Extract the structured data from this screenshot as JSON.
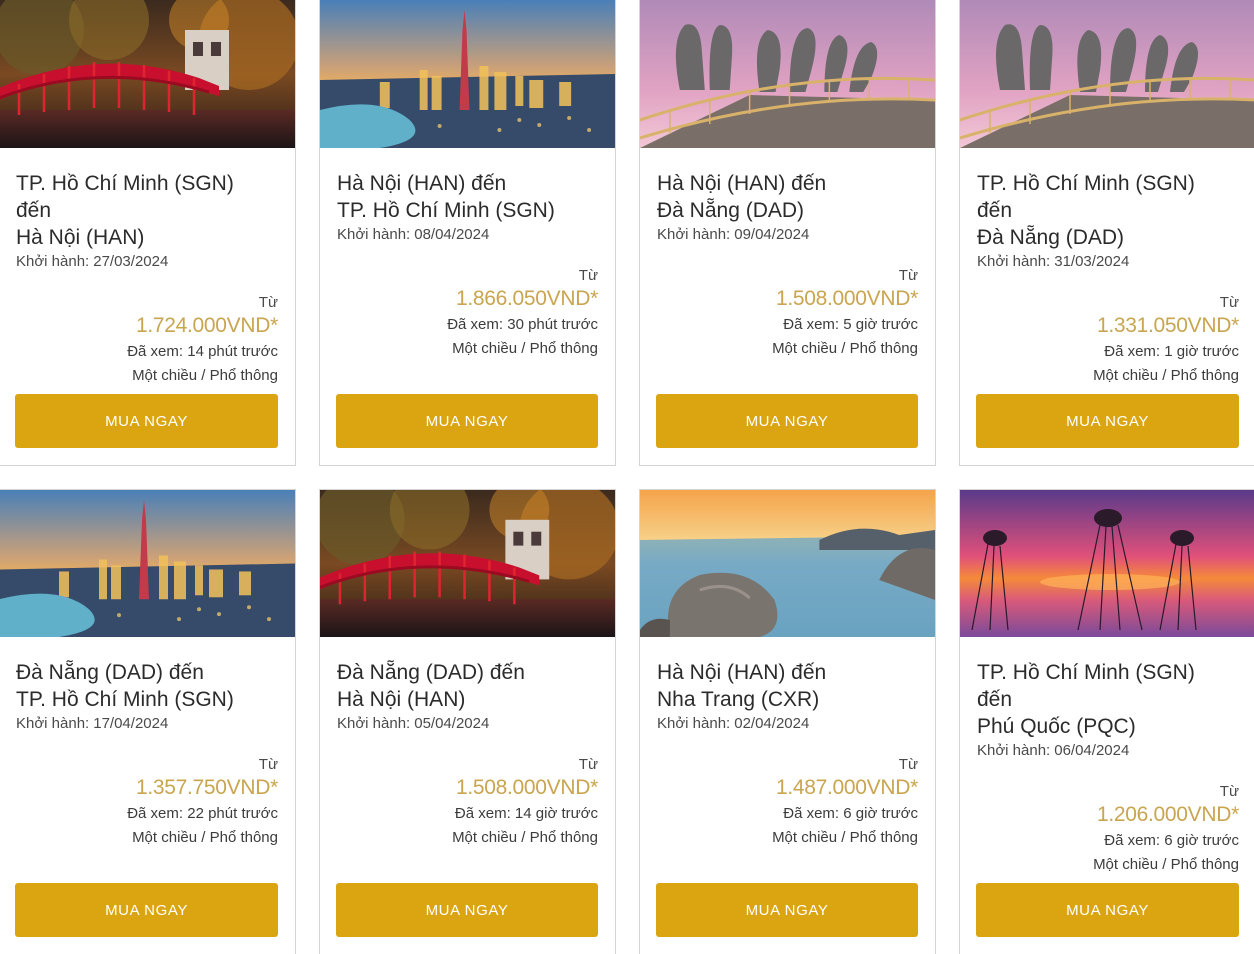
{
  "common": {
    "depart_label": "Khởi hành:",
    "from_label": "Từ",
    "buy_label": "MUA NGAY"
  },
  "cards": [
    {
      "route_lines": [
        "TP. Hồ Chí Minh (SGN)",
        "đến",
        "Hà Nội (HAN)"
      ],
      "depart_date": "27/03/2024",
      "price": "1.724.000VND*",
      "viewed": "Đã xem: 14 phút trước",
      "fare": "Một chiều / Phổ thông",
      "image": "hanoi-red-bridge"
    },
    {
      "route_lines": [
        "Hà Nội (HAN) đến",
        "TP. Hồ Chí Minh (SGN)"
      ],
      "depart_date": "08/04/2024",
      "price": "1.866.050VND*",
      "viewed": "Đã xem: 30 phút trước",
      "fare": "Một chiều / Phổ thông",
      "image": "saigon-skyline"
    },
    {
      "route_lines": [
        "Hà Nội (HAN) đến",
        "Đà Nẵng (DAD)"
      ],
      "depart_date": "09/04/2024",
      "price": "1.508.000VND*",
      "viewed": "Đã xem: 5 giờ trước",
      "fare": "Một chiều / Phổ thông",
      "image": "golden-bridge-hands"
    },
    {
      "route_lines": [
        "TP. Hồ Chí Minh (SGN)",
        "đến",
        "Đà Nẵng (DAD)"
      ],
      "depart_date": "31/03/2024",
      "price": "1.331.050VND*",
      "viewed": "Đã xem: 1 giờ trước",
      "fare": "Một chiều / Phổ thông",
      "image": "golden-bridge-hands"
    },
    {
      "route_lines": [
        "Đà Nẵng (DAD) đến",
        "TP. Hồ Chí Minh (SGN)"
      ],
      "depart_date": "17/04/2024",
      "price": "1.357.750VND*",
      "viewed": "Đã xem: 22 phút trước",
      "fare": "Một chiều / Phổ thông",
      "image": "saigon-skyline"
    },
    {
      "route_lines": [
        "Đà Nẵng (DAD) đến",
        "Hà Nội (HAN)"
      ],
      "depart_date": "05/04/2024",
      "price": "1.508.000VND*",
      "viewed": "Đã xem: 14 giờ trước",
      "fare": "Một chiều / Phổ thông",
      "image": "hanoi-red-bridge"
    },
    {
      "route_lines": [
        "Hà Nội (HAN) đến",
        "Nha Trang (CXR)"
      ],
      "depart_date": "02/04/2024",
      "price": "1.487.000VND*",
      "viewed": "Đã xem: 6 giờ trước",
      "fare": "Một chiều / Phổ thông",
      "image": "nha-trang-rocks"
    },
    {
      "route_lines": [
        "TP. Hồ Chí Minh (SGN)",
        "đến",
        "Phú Quốc (PQC)"
      ],
      "depart_date": "06/04/2024",
      "price": "1.206.000VND*",
      "viewed": "Đã xem: 6 giờ trước",
      "fare": "Một chiều / Phổ thông",
      "image": "phu-quoc-elephants"
    }
  ],
  "colors": {
    "accent_gold": "#dba511",
    "price_gold": "#c9a54f",
    "border": "#d4d4d4"
  }
}
